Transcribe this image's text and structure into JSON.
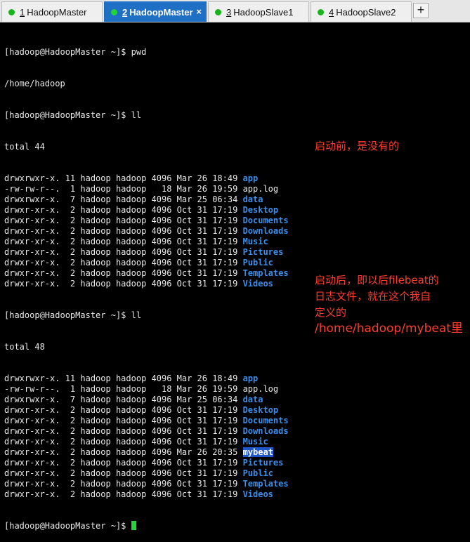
{
  "tabs": [
    {
      "num": "1",
      "label": "HadoopMaster",
      "active": false,
      "closable": false
    },
    {
      "num": "2",
      "label": "HadoopMaster",
      "active": true,
      "closable": true
    },
    {
      "num": "3",
      "label": "HadoopSlave1",
      "active": false,
      "closable": false
    },
    {
      "num": "4",
      "label": "HadoopSlave2",
      "active": false,
      "closable": false
    }
  ],
  "add_tab_label": "+",
  "close_label": "×",
  "terminal": {
    "prompt": "[hadoop@HadoopMaster ~]$ ",
    "cmd_pwd": "pwd",
    "pwd_output": "/home/hadoop",
    "cmd_ll": "ll",
    "total1": "total 44",
    "total2": "total 48",
    "listing1": [
      {
        "meta": "drwxrwxr-x. 11 hadoop hadoop 4096 Mar 26 18:49 ",
        "name": "app",
        "type": "dir"
      },
      {
        "meta": "-rw-rw-r--.  1 hadoop hadoop   18 Mar 26 19:59 ",
        "name": "app.log",
        "type": "file"
      },
      {
        "meta": "drwxrwxr-x.  7 hadoop hadoop 4096 Mar 25 06:34 ",
        "name": "data",
        "type": "dir"
      },
      {
        "meta": "drwxr-xr-x.  2 hadoop hadoop 4096 Oct 31 17:19 ",
        "name": "Desktop",
        "type": "dir"
      },
      {
        "meta": "drwxr-xr-x.  2 hadoop hadoop 4096 Oct 31 17:19 ",
        "name": "Documents",
        "type": "dir"
      },
      {
        "meta": "drwxr-xr-x.  2 hadoop hadoop 4096 Oct 31 17:19 ",
        "name": "Downloads",
        "type": "dir"
      },
      {
        "meta": "drwxr-xr-x.  2 hadoop hadoop 4096 Oct 31 17:19 ",
        "name": "Music",
        "type": "dir"
      },
      {
        "meta": "drwxr-xr-x.  2 hadoop hadoop 4096 Oct 31 17:19 ",
        "name": "Pictures",
        "type": "dir"
      },
      {
        "meta": "drwxr-xr-x.  2 hadoop hadoop 4096 Oct 31 17:19 ",
        "name": "Public",
        "type": "dir"
      },
      {
        "meta": "drwxr-xr-x.  2 hadoop hadoop 4096 Oct 31 17:19 ",
        "name": "Templates",
        "type": "dir"
      },
      {
        "meta": "drwxr-xr-x.  2 hadoop hadoop 4096 Oct 31 17:19 ",
        "name": "Videos",
        "type": "dir"
      }
    ],
    "listing2": [
      {
        "meta": "drwxrwxr-x. 11 hadoop hadoop 4096 Mar 26 18:49 ",
        "name": "app",
        "type": "dir"
      },
      {
        "meta": "-rw-rw-r--.  1 hadoop hadoop   18 Mar 26 19:59 ",
        "name": "app.log",
        "type": "file"
      },
      {
        "meta": "drwxrwxr-x.  7 hadoop hadoop 4096 Mar 25 06:34 ",
        "name": "data",
        "type": "dir"
      },
      {
        "meta": "drwxr-xr-x.  2 hadoop hadoop 4096 Oct 31 17:19 ",
        "name": "Desktop",
        "type": "dir"
      },
      {
        "meta": "drwxr-xr-x.  2 hadoop hadoop 4096 Oct 31 17:19 ",
        "name": "Documents",
        "type": "dir"
      },
      {
        "meta": "drwxr-xr-x.  2 hadoop hadoop 4096 Oct 31 17:19 ",
        "name": "Downloads",
        "type": "dir"
      },
      {
        "meta": "drwxr-xr-x.  2 hadoop hadoop 4096 Oct 31 17:19 ",
        "name": "Music",
        "type": "dir"
      },
      {
        "meta": "drwxr-xr-x.  2 hadoop hadoop 4096 Mar 26 20:35 ",
        "name": "mybeat",
        "type": "highlight"
      },
      {
        "meta": "drwxr-xr-x.  2 hadoop hadoop 4096 Oct 31 17:19 ",
        "name": "Pictures",
        "type": "dir"
      },
      {
        "meta": "drwxr-xr-x.  2 hadoop hadoop 4096 Oct 31 17:19 ",
        "name": "Public",
        "type": "dir"
      },
      {
        "meta": "drwxr-xr-x.  2 hadoop hadoop 4096 Oct 31 17:19 ",
        "name": "Templates",
        "type": "dir"
      },
      {
        "meta": "drwxr-xr-x.  2 hadoop hadoop 4096 Oct 31 17:19 ",
        "name": "Videos",
        "type": "dir"
      }
    ]
  },
  "annotations": {
    "before": "启动前，是没有的",
    "after_line1": "启动后，即以后filebeat的",
    "after_line2": "日志文件，就在这个我自",
    "after_line3": "定义的",
    "after_line4": "/home/hadoop/mybeat里"
  },
  "colors": {
    "tab_active": "#1f6fc4",
    "status_dot": "#17b51b",
    "directory": "#3b8eea",
    "annotation": "#ff3b2f",
    "cursor": "#22d33a"
  }
}
